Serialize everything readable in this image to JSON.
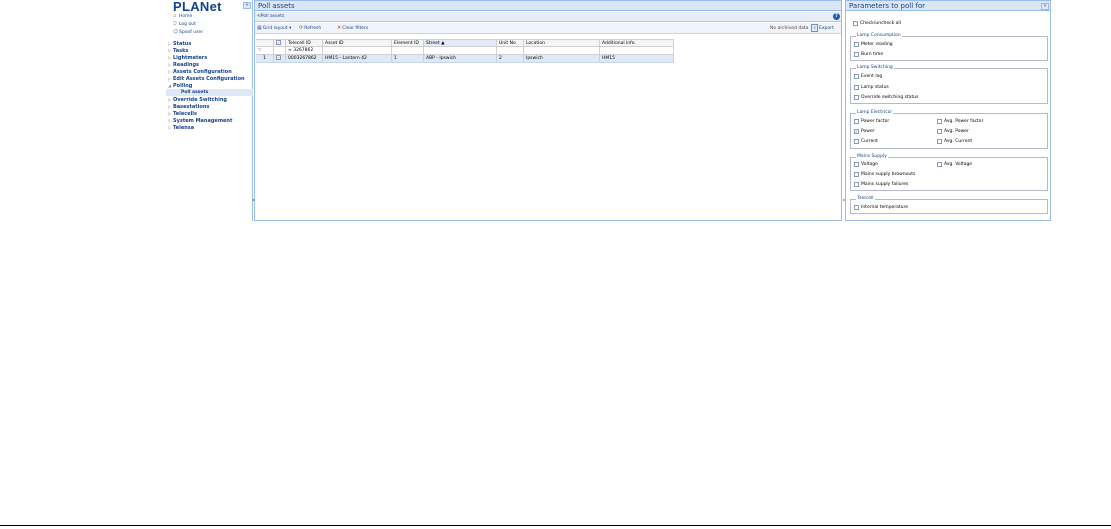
{
  "sidebar": {
    "logo": "PLANet",
    "collapse_icon": "«",
    "top_links": [
      {
        "label": "Home",
        "icon": "home-icon"
      },
      {
        "label": "Log out",
        "icon": "logout-icon"
      },
      {
        "label": "Spoof user",
        "icon": "user-icon"
      }
    ],
    "items": [
      {
        "label": "Status",
        "arrow": "▷"
      },
      {
        "label": "Tasks",
        "arrow": "▷"
      },
      {
        "label": "Lightmeters",
        "arrow": "▷"
      },
      {
        "label": "Readings",
        "arrow": "▷"
      },
      {
        "label": "Assets Configuration",
        "arrow": "▷"
      },
      {
        "label": "Edit Assets Configuration",
        "arrow": "▷"
      },
      {
        "label": "Polling",
        "arrow": "◢"
      }
    ],
    "sub_item": "Poll assets",
    "items_after": [
      {
        "label": "Override Switching",
        "arrow": "▷"
      },
      {
        "label": "Basestations",
        "arrow": "▷"
      },
      {
        "label": "Telecells",
        "arrow": "▷"
      },
      {
        "label": "System Management",
        "arrow": "▷"
      },
      {
        "label": "Telensa",
        "arrow": "▷"
      }
    ]
  },
  "main": {
    "title": "Poll assets",
    "tab_label": "Poll assets",
    "help_icon": "?",
    "toolbar": {
      "grid_layout": "Grid layout ▾",
      "refresh": "Refresh",
      "clear_filters": "Clear filters",
      "no_archived": "No archived data",
      "export": "Export"
    },
    "grid": {
      "columns": [
        "",
        "",
        "Telecell ID",
        "Asset ID",
        "Element ID",
        "Street ▲",
        "Unit No",
        "Location",
        "Additional info."
      ],
      "filter_value": "≈ 3267862",
      "rows": [
        {
          "num": "1",
          "checked": "✓",
          "telecell_id": "0003267862",
          "asset_id": "HM15 - Lantern 42",
          "element_id": "1",
          "street": "ABP - Ipswich",
          "unit_no": "2",
          "location": "Ipswich",
          "additional": "HM15"
        }
      ]
    }
  },
  "right_panel": {
    "title": "Parameters to poll for",
    "collapse_icon": "»",
    "check_all": "Check/uncheck all",
    "groups": [
      {
        "legend": "Lamp Consumption",
        "items": [
          "Meter reading",
          "Burn time"
        ]
      },
      {
        "legend": "Lamp Switching",
        "items": [
          "Event log",
          "Lamp status",
          "Override switching status"
        ]
      },
      {
        "legend": "Lamp Electrical",
        "items": [
          "Power factor",
          "Avg. Power factor",
          "Power",
          "Avg. Power",
          "Current",
          "Avg. Current"
        ]
      },
      {
        "legend": "Mains Supply",
        "items": [
          "Voltage",
          "Avg. Voltage",
          "Mains supply brownouts",
          "Mains supply failures"
        ]
      },
      {
        "legend": "Telecell",
        "items": [
          "Internal temperature"
        ]
      }
    ],
    "checked_items": [
      "Power"
    ]
  },
  "colors": {
    "accent": "#15428b",
    "header_bg": "#dae6f4",
    "border": "#99bbe8",
    "selected_row": "#dfe8f6"
  }
}
